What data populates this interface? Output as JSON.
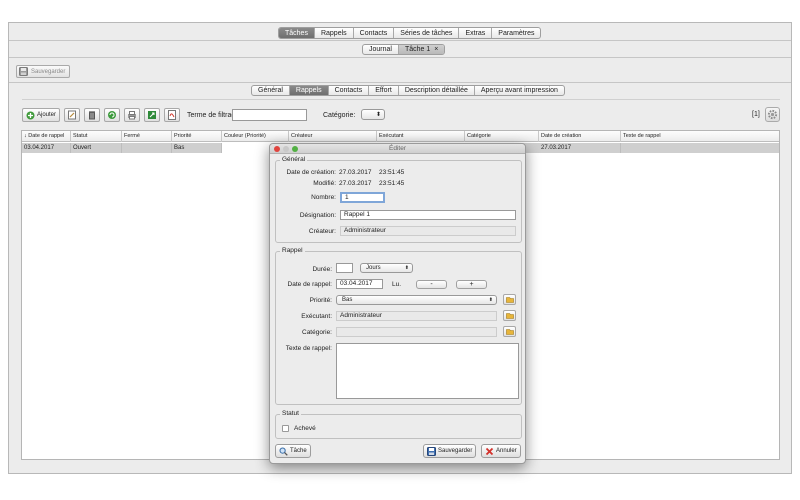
{
  "top_tabs": [
    "Tâches",
    "Rappels",
    "Contacts",
    "Séries de tâches",
    "Extras",
    "Paramètres"
  ],
  "top_tabs_active": 0,
  "doc_tabs": {
    "journal": "Journal",
    "task": "Tâche 1",
    "close": "×"
  },
  "save_button": "Sauvegarder",
  "sub_tabs": [
    "Général",
    "Rappels",
    "Contacts",
    "Effort",
    "Description détaillée",
    "Aperçu avant impression"
  ],
  "sub_tabs_active": 1,
  "toolbar": {
    "add_label": "Ajouter",
    "filter_label": "Terme de filtrage:",
    "filter_value": "",
    "category_label": "Catégorie:",
    "count": "[1]"
  },
  "table": {
    "columns": [
      "↓ Date de rappel",
      "Statut",
      "Fermé",
      "Priorité",
      "Couleur (Priorité)",
      "Créateur",
      "Exécutant",
      "Catégorie",
      "Date de création",
      "Texte de rappel"
    ],
    "rows": [
      [
        "03.04.2017",
        "Ouvert",
        "",
        "Bas",
        "",
        "",
        "",
        "",
        "27.03.2017",
        ""
      ]
    ]
  },
  "dialog": {
    "title": "Éditer",
    "general_group": "Général",
    "created_label": "Date de création:",
    "created_date": "27.03.2017",
    "created_time": "23:51:45",
    "modified_label": "Modifié:",
    "modified_date": "27.03.2017",
    "modified_time": "23:51:45",
    "number_label": "Nombre:",
    "number_value": "1",
    "designation_label": "Désignation:",
    "designation_value": "Rappel 1",
    "creator_label": "Créateur:",
    "creator_value": "Administrateur",
    "reminder_group": "Rappel",
    "duration_label": "Durée:",
    "duration_value": "",
    "duration_unit": "Jours",
    "reminder_date_label": "Date de rappel:",
    "reminder_date_value": "03.04.2017",
    "weekday": "Lu.",
    "minus": "-",
    "plus": "+",
    "priority_label": "Priorité:",
    "priority_value": "Bas",
    "executor_label": "Exécutant:",
    "executor_value": "Administrateur",
    "category_label": "Catégorie:",
    "category_value": "",
    "reminder_text_label": "Texte de rappel:",
    "status_group": "Statut",
    "done_label": "Achevé",
    "task_button": "Tâche",
    "save_button": "Sauvegarder",
    "cancel_button": "Annuler"
  },
  "colors": {
    "active_tab": "#7a7a7a",
    "selected_row": "#cfcfcf",
    "close_light": "#e0443e",
    "minimize_light": "#c8c8c8",
    "zoom_light": "#52b043"
  }
}
